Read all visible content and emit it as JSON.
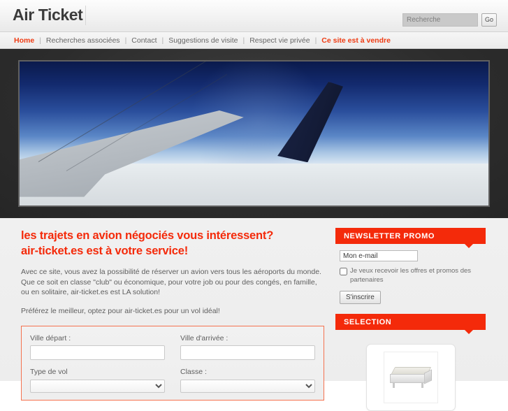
{
  "header": {
    "logo": "Air Ticket",
    "search": {
      "placeholder": "Recherche",
      "value": "",
      "button_label": "Go"
    }
  },
  "nav": {
    "separator": "|",
    "items": [
      {
        "label": "Home",
        "state": "active"
      },
      {
        "label": "Recherches associées",
        "state": "normal"
      },
      {
        "label": "Contact",
        "state": "normal"
      },
      {
        "label": "Suggestions de visite",
        "state": "normal"
      },
      {
        "label": "Respect vie privée",
        "state": "normal"
      },
      {
        "label": "Ce site est à vendre",
        "state": "sale"
      }
    ]
  },
  "hero": {
    "alt": "airplane-wing-over-clouds"
  },
  "main": {
    "headline_line1": "les trajets en avion négociés vous intéressent?",
    "headline_line2": "air-ticket.es est à votre service!",
    "paragraph1": "Avec ce site, vous avez la possibilité de réserver un avion vers tous les aéroports du monde. Que ce soit en classe \"club\" ou économique, pour votre job ou pour des congés, en famille, ou en solitaire, air-ticket.es est LA solution!",
    "paragraph2": "Préférez le meilleur, optez pour air-ticket.es pour un vol idéal!",
    "form": {
      "departure_label": "Ville départ :",
      "departure_value": "",
      "arrival_label": "Ville d'arrivée :",
      "arrival_value": "",
      "flight_type_label": "Type de vol",
      "flight_type_value": "",
      "class_label": "Classe :",
      "class_value": ""
    }
  },
  "sidebar": {
    "newsletter": {
      "title": "NEWSLETTER PROMO",
      "email_value": "Mon e-mail",
      "checkbox_label": "Je veux recevoir les offres et promos des partenaires",
      "checkbox_checked": false,
      "submit_label": "S'inscrire"
    },
    "selection": {
      "title": "SELECTION",
      "product_alt": "bed-product-image"
    }
  },
  "colors": {
    "accent_red": "#f42a0a",
    "nav_text": "#666666",
    "body_text": "#5e5e5e",
    "hero_band": "#2c2c2c"
  }
}
